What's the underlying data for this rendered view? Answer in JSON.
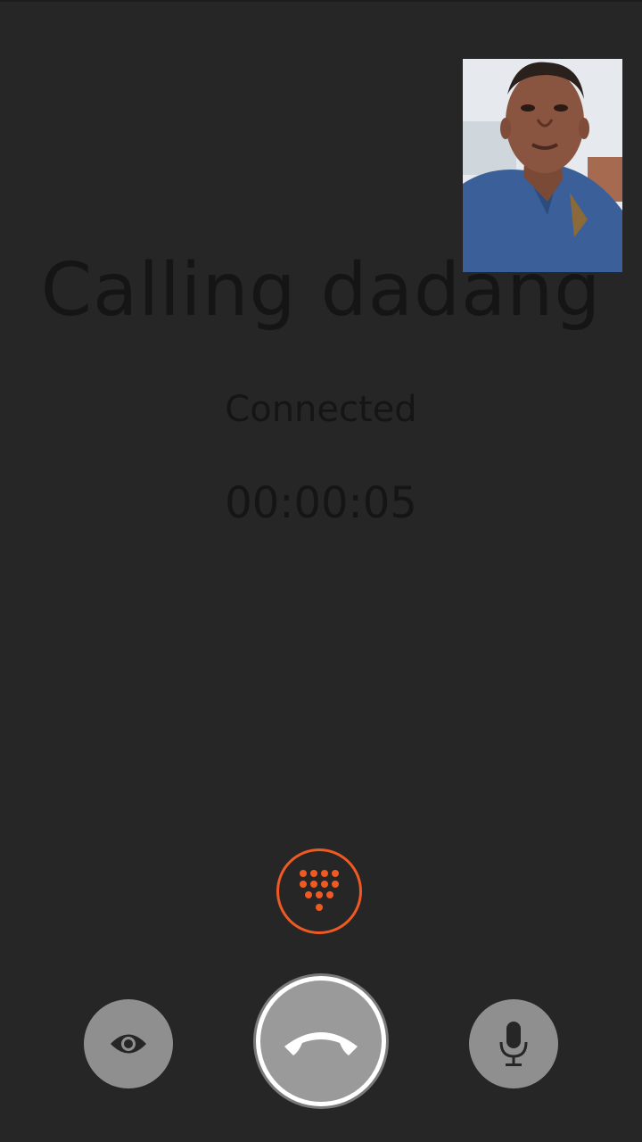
{
  "call": {
    "title": "Calling dadang",
    "status": "Connected",
    "timer": "00:00:05"
  },
  "controls": {
    "dialpad_icon": "dialpad-icon",
    "hangup_icon": "hangup-phone-icon",
    "camera_toggle_icon": "eye-icon",
    "mute_icon": "microphone-icon"
  },
  "colors": {
    "background": "#262626",
    "accent": "#f05a22",
    "button_gray": "#8f8f8f"
  }
}
